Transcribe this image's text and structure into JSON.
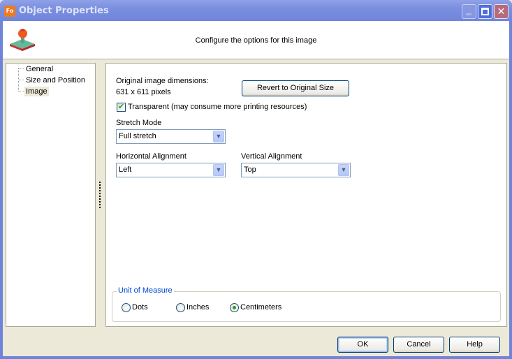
{
  "window": {
    "title": "Object Properties",
    "app_icon_text": "Fo",
    "controls": {
      "minimize": "minimize-icon",
      "maximize": "maximize-icon",
      "close": "close-icon"
    }
  },
  "header": {
    "icon": "stamp-icon",
    "text": "Configure the options for this image"
  },
  "tree": {
    "items": [
      {
        "label": "General",
        "selected": false
      },
      {
        "label": "Size and Position",
        "selected": false
      },
      {
        "label": "Image",
        "selected": true
      }
    ]
  },
  "image_panel": {
    "dimensions_label": "Original image dimensions:",
    "dimensions_value": "631 x 611 pixels",
    "revert_button": "Revert to Original Size",
    "transparent": {
      "label": "Transparent (may consume more printing resources)",
      "checked": true
    },
    "stretch_mode": {
      "label": "Stretch Mode",
      "value": "Full stretch"
    },
    "horizontal_alignment": {
      "label": "Horizontal Alignment",
      "value": "Left"
    },
    "vertical_alignment": {
      "label": "Vertical Alignment",
      "value": "Top"
    },
    "unit_of_measure": {
      "title": "Unit of Measure",
      "options": [
        {
          "label": "Dots",
          "checked": false
        },
        {
          "label": "Inches",
          "checked": false
        },
        {
          "label": "Centimeters",
          "checked": true
        }
      ]
    }
  },
  "footer": {
    "ok": "OK",
    "cancel": "Cancel",
    "help": "Help"
  },
  "colors": {
    "titlebar": "#7b8fe0",
    "dialog_bg": "#ece9d8",
    "group_title": "#0046d5",
    "check_green": "#21a121"
  }
}
